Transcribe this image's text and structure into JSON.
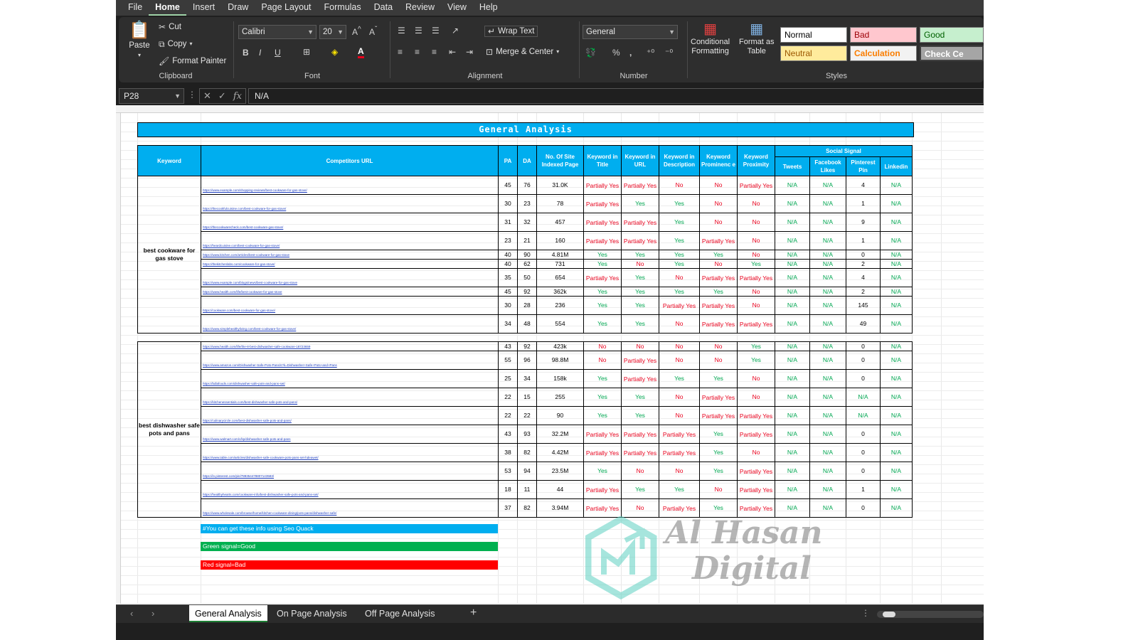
{
  "menu": [
    "File",
    "Home",
    "Insert",
    "Draw",
    "Page Layout",
    "Formulas",
    "Data",
    "Review",
    "View",
    "Help"
  ],
  "active_menu": "Home",
  "ribbon": {
    "clipboard": {
      "paste": "Paste",
      "cut": "Cut",
      "copy": "Copy",
      "format_painter": "Format Painter",
      "label": "Clipboard"
    },
    "font": {
      "name": "Calibri",
      "size": "20",
      "label": "Font"
    },
    "alignment": {
      "wrap": "Wrap Text",
      "merge": "Merge & Center",
      "label": "Alignment"
    },
    "number": {
      "format": "General",
      "label": "Number"
    },
    "styles": {
      "conditional": "Conditional",
      "conditional2": "Formatting",
      "format_as": "Format as",
      "format_as2": "Table",
      "normal": "Normal",
      "bad": "Bad",
      "good": "Good",
      "neutral": "Neutral",
      "calculation": "Calculation",
      "check": "Check Ce",
      "label": "Styles"
    }
  },
  "formula_bar": {
    "cell": "P28",
    "value": "N/A"
  },
  "title": "General Analysis",
  "headers": {
    "keyword": "Keyword",
    "url": "Competitors URL",
    "pa": "PA",
    "da": "DA",
    "indexed": "No. Of Site Indexed Page",
    "kw_title": "Keyword in Title",
    "kw_url": "Keyword in URL",
    "kw_desc": "Keyword in Description",
    "kw_prom": "Keyword Prominenc e",
    "kw_prox": "Keyword Proximity",
    "social": "Social Signal",
    "tweets": "Tweets",
    "facebook": "Facebook Likes",
    "pinterest": "Pinterest Pin",
    "linkedin": "Linkedin"
  },
  "groups": [
    {
      "keyword": "best cookware for gas stove",
      "rows": [
        {
          "url": "https://www.example.com/shopping-reviews/best-cookware-for-gas-stove/",
          "pa": "45",
          "da": "76",
          "idx": "31.0K",
          "t": "Partially Yes",
          "u": "Partially Yes",
          "d": "No",
          "p": "No",
          "x": "Partially Yes",
          "tw": "N/A",
          "fb": "N/A",
          "pin": "4",
          "li": "N/A"
        },
        {
          "url": "https://thecookfulcuisine.com/best-cookware-for-gas-stove/",
          "pa": "30",
          "da": "23",
          "idx": "78",
          "t": "Partially Yes",
          "u": "Yes",
          "d": "Yes",
          "p": "No",
          "x": "No",
          "tw": "N/A",
          "fb": "N/A",
          "pin": "1",
          "li": "N/A"
        },
        {
          "url": "https://thecookwarecheck.com/best-cookware-gas-stove/",
          "pa": "31",
          "da": "32",
          "idx": "457",
          "t": "Partially Yes",
          "u": "Partially Yes",
          "d": "Yes",
          "p": "No",
          "x": "No",
          "tw": "N/A",
          "fb": "N/A",
          "pin": "9",
          "li": "N/A"
        },
        {
          "url": "https://heardcuisine.com/best-cookware-for-gas-stove/",
          "pa": "23",
          "da": "21",
          "idx": "160",
          "t": "Partially Yes",
          "u": "Partially Yes",
          "d": "Yes",
          "p": "Partially Yes",
          "x": "No",
          "tw": "N/A",
          "fb": "N/A",
          "pin": "1",
          "li": "N/A"
        },
        {
          "url": "https://www.kitchen.com/articles/best-cookware-for-gas-stove",
          "pa": "40",
          "da": "90",
          "idx": "4.81M",
          "t": "Yes",
          "u": "Yes",
          "d": "Yes",
          "p": "Yes",
          "x": "No",
          "tw": "N/A",
          "fb": "N/A",
          "pin": "0",
          "li": "N/A"
        },
        {
          "url": "https://thekitchenlabs.com/cookware-for-gas-stove/",
          "pa": "40",
          "da": "62",
          "idx": "731",
          "t": "Yes",
          "u": "No",
          "d": "Yes",
          "p": "No",
          "x": "Yes",
          "tw": "N/A",
          "fb": "N/A",
          "pin": "2",
          "li": "N/A"
        },
        {
          "url": "https://www.example.com/blogs/news/best-cookware-for-gas-stove",
          "pa": "35",
          "da": "50",
          "idx": "654",
          "t": "Partially Yes",
          "u": "Yes",
          "d": "No",
          "p": "Partially Yes",
          "x": "Partially Yes",
          "tw": "N/A",
          "fb": "N/A",
          "pin": "4",
          "li": "N/A"
        },
        {
          "url": "https://www.health.com/life/best-cookware-for-gas-stove",
          "pa": "45",
          "da": "92",
          "idx": "362k",
          "t": "Yes",
          "u": "Yes",
          "d": "Yes",
          "p": "Yes",
          "x": "No",
          "tw": "N/A",
          "fb": "N/A",
          "pin": "2",
          "li": "N/A"
        },
        {
          "url": "https://cookware.com/best-cookware-for-gas-stove/",
          "pa": "30",
          "da": "28",
          "idx": "236",
          "t": "Yes",
          "u": "Yes",
          "d": "Partially Yes",
          "p": "Partially Yes",
          "x": "No",
          "tw": "N/A",
          "fb": "N/A",
          "pin": "145",
          "li": "N/A"
        },
        {
          "url": "https://www.simplehealthyliving.com/best-cookware-for-gas-stove/",
          "pa": "34",
          "da": "48",
          "idx": "554",
          "t": "Yes",
          "u": "Yes",
          "d": "No",
          "p": "Partially Yes",
          "x": "Partially Yes",
          "tw": "N/A",
          "fb": "N/A",
          "pin": "49",
          "li": "N/A"
        }
      ]
    },
    {
      "keyword": "best dishwasher safe pots and pans",
      "rows": [
        {
          "url": "https://www.health.com/life/the-8-best-dishwasher-safe-cookware-18723659",
          "pa": "43",
          "da": "92",
          "idx": "423k",
          "t": "No",
          "u": "No",
          "d": "No",
          "p": "No",
          "x": "Yes",
          "tw": "N/A",
          "fb": "N/A",
          "pin": "0",
          "li": "N/A"
        },
        {
          "url": "https://www.amazon.com/Dishwasher-Safe-Pots-Pans/s?k=Dishwasher+Safe+Pots+and+Pans",
          "pa": "55",
          "da": "96",
          "idx": "98.8M",
          "t": "No",
          "u": "Partially Yes",
          "d": "No",
          "p": "No",
          "x": "Yes",
          "tw": "N/A",
          "fb": "N/A",
          "pin": "0",
          "li": "N/A"
        },
        {
          "url": "https://bdlafoods.com/dishwasher-safe-pots-and-pans-set/",
          "pa": "25",
          "da": "34",
          "idx": "158k",
          "t": "Yes",
          "u": "Partially Yes",
          "d": "Yes",
          "p": "Yes",
          "x": "No",
          "tw": "N/A",
          "fb": "N/A",
          "pin": "0",
          "li": "N/A"
        },
        {
          "url": "https://kitchenessentials.com/best-dishwasher-safe-pots-and-pans/",
          "pa": "22",
          "da": "15",
          "idx": "255",
          "t": "Yes",
          "u": "Yes",
          "d": "No",
          "p": "Partially Yes",
          "x": "No",
          "tw": "N/A",
          "fb": "N/A",
          "pin": "N/A",
          "li": "N/A"
        },
        {
          "url": "https://culinarycircle.com/best-dishwasher-safe-pots-and-pans/",
          "pa": "22",
          "da": "22",
          "idx": "90",
          "t": "Yes",
          "u": "Yes",
          "d": "No",
          "p": "Partially Yes",
          "x": "Partially Yes",
          "tw": "N/A",
          "fb": "N/A",
          "pin": "N/A",
          "li": "N/A"
        },
        {
          "url": "https://www.walmart.com/c/kp/dishwasher-safe-pots-and-pans",
          "pa": "43",
          "da": "93",
          "idx": "32.2M",
          "t": "Partially Yes",
          "u": "Partially Yes",
          "d": "Partially Yes",
          "p": "Yes",
          "x": "Partially Yes",
          "tw": "N/A",
          "fb": "N/A",
          "pin": "0",
          "li": "N/A"
        },
        {
          "url": "https://www.table.com/articles/dishwasher-safe-cookware-pots-pans-set-hdeawet/",
          "pa": "38",
          "da": "82",
          "idx": "4.42M",
          "t": "Partially Yes",
          "u": "Partially Yes",
          "d": "Partially Yes",
          "p": "Yes",
          "x": "No",
          "tw": "N/A",
          "fb": "N/A",
          "pin": "0",
          "li": "N/A"
        },
        {
          "url": "https://in.pinterest.com/pin/789354478807143583/",
          "pa": "53",
          "da": "94",
          "idx": "23.5M",
          "t": "Yes",
          "u": "No",
          "d": "No",
          "p": "Yes",
          "x": "Partially Yes",
          "tw": "N/A",
          "fb": "N/A",
          "pin": "0",
          "li": "N/A"
        },
        {
          "url": "https://healthyhearts.com/cookware-info/best-dishwasher-safe-pots-and-pans-set/",
          "pa": "18",
          "da": "11",
          "idx": "44",
          "t": "Partially Yes",
          "u": "Yes",
          "d": "Yes",
          "p": "No",
          "x": "Partially Yes",
          "tw": "N/A",
          "fb": "N/A",
          "pin": "1",
          "li": "N/A"
        },
        {
          "url": "https://www.wholesale.com/browse/home/kitchen-cookware-dining/pots-pans/dishwasher-safe/",
          "pa": "37",
          "da": "82",
          "idx": "3.94M",
          "t": "Partially Yes",
          "u": "No",
          "d": "Partially Yes",
          "p": "Yes",
          "x": "Partially Yes",
          "tw": "N/A",
          "fb": "N/A",
          "pin": "0",
          "li": "N/A"
        }
      ]
    }
  ],
  "notes": [
    "#You can get these info using Seo Quack",
    "Green signal=Good",
    "Red signal=Bad"
  ],
  "watermark": {
    "line1": "Al Hasan",
    "line2": "Digital"
  },
  "sheets": [
    "General Analysis",
    "On Page Analysis",
    "Off Page Analysis"
  ],
  "active_sheet": "General Analysis",
  "colors": {
    "title_blue": "#00aeef",
    "good_green": "#00a651",
    "bad_red": "#e8001c",
    "note_green": "#00b050",
    "note_red": "#ff0000"
  }
}
